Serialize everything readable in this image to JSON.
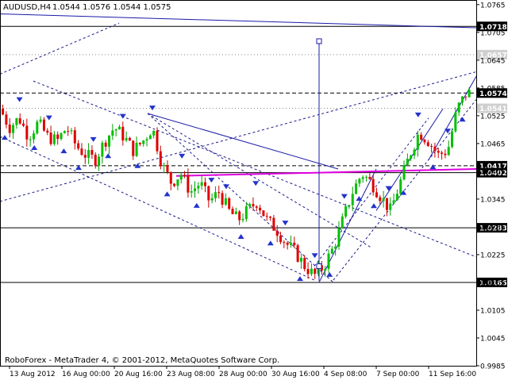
{
  "chart_data": {
    "type": "candlestick",
    "header": {
      "symbol": "AUDUSD,H4",
      "ohlc": "1.0544 1.0576 1.0544 1.0575"
    },
    "footer_text": "RoboForex - MetaTrader 4, © 2001-2012, MetaQuotes Software Corp.",
    "ylim": [
      0.9985,
      1.0775
    ],
    "y_ticks": [
      "1.0765",
      "1.0705",
      "1.0645",
      "1.0585",
      "1.0525",
      "1.0465",
      "1.0405",
      "1.0345",
      "1.0285",
      "1.0225",
      "1.0165",
      "1.0105",
      "1.0045",
      "0.9985"
    ],
    "x_ticks": [
      "13 Aug 2012",
      "16 Aug 00:00",
      "20 Aug 16:00",
      "23 Aug 08:00",
      "28 Aug 00:00",
      "30 Aug 16:00",
      "4 Sep 08:00",
      "7 Sep 00:00",
      "11 Sep 16:00"
    ],
    "x_range": [
      0,
      100
    ],
    "x_tick_positions": [
      2,
      13,
      24,
      35,
      46,
      57,
      68,
      79,
      90
    ],
    "price_levels": [
      {
        "label": "1.0718",
        "value": 1.0718,
        "style": "solid"
      },
      {
        "label": "1.0657",
        "value": 1.0657,
        "style": "dotted"
      },
      {
        "label": "1.0574",
        "value": 1.0574,
        "style": "dashed"
      },
      {
        "label": "1.0541",
        "value": 1.0541,
        "style": "dotted"
      },
      {
        "label": "1.0417",
        "value": 1.0417,
        "style": "dashed"
      },
      {
        "label": "1.0402",
        "value": 1.0402,
        "style": "solid"
      },
      {
        "label": "1.0283",
        "value": 1.0283,
        "style": "solid"
      },
      {
        "label": "1.0165",
        "value": 1.0165,
        "style": "solid"
      }
    ],
    "close_path": [
      [
        0,
        1.054
      ],
      [
        2,
        1.05
      ],
      [
        4,
        1.052
      ],
      [
        6,
        1.048
      ],
      [
        8,
        1.051
      ],
      [
        10,
        1.048
      ],
      [
        12,
        1.047
      ],
      [
        14,
        1.05
      ],
      [
        16,
        1.046
      ],
      [
        18,
        1.044
      ],
      [
        20,
        1.043
      ],
      [
        22,
        1.047
      ],
      [
        24,
        1.05
      ],
      [
        26,
        1.048
      ],
      [
        28,
        1.045
      ],
      [
        30,
        1.047
      ],
      [
        32,
        1.05
      ],
      [
        34,
        1.042
      ],
      [
        36,
        1.038
      ],
      [
        38,
        1.04
      ],
      [
        40,
        1.036
      ],
      [
        42,
        1.038
      ],
      [
        44,
        1.034
      ],
      [
        46,
        1.036
      ],
      [
        48,
        1.032
      ],
      [
        50,
        1.03
      ],
      [
        52,
        1.032
      ],
      [
        54,
        1.034
      ],
      [
        56,
        1.03
      ],
      [
        58,
        1.028
      ],
      [
        60,
        1.025
      ],
      [
        62,
        1.023
      ],
      [
        64,
        1.02
      ],
      [
        66,
        1.018
      ],
      [
        68,
        1.02
      ],
      [
        70,
        1.024
      ],
      [
        72,
        1.03
      ],
      [
        74,
        1.036
      ],
      [
        76,
        1.04
      ],
      [
        78,
        1.038
      ],
      [
        80,
        1.035
      ],
      [
        82,
        1.032
      ],
      [
        84,
        1.038
      ],
      [
        86,
        1.044
      ],
      [
        88,
        1.049
      ],
      [
        90,
        1.047
      ],
      [
        92,
        1.044
      ],
      [
        94,
        1.045
      ],
      [
        96,
        1.054
      ],
      [
        98,
        1.0575
      ]
    ],
    "trend_lines": [
      {
        "name": "top-channel",
        "style": "solid",
        "from": [
          0,
          1.0745
        ],
        "to": [
          100,
          1.0715
        ]
      },
      {
        "name": "fan-1",
        "style": "solid",
        "from": [
          31,
          1.053
        ],
        "to": [
          71,
          1.041
        ]
      },
      {
        "name": "dotted-upper",
        "style": "dotted",
        "from": [
          0,
          1.0615
        ],
        "to": [
          25,
          1.0725
        ]
      },
      {
        "name": "dotted-long",
        "style": "dotted",
        "from": [
          7,
          1.06
        ],
        "to": [
          100,
          1.022
        ]
      },
      {
        "name": "dotted-channel-1",
        "style": "dotted",
        "from": [
          0,
          1.048
        ],
        "to": [
          66,
          1.017
        ]
      },
      {
        "name": "dotted-channel-2",
        "style": "dotted",
        "from": [
          31,
          1.053
        ],
        "to": [
          78,
          1.024
        ]
      },
      {
        "name": "dotted-rise",
        "style": "dotted",
        "from": [
          0,
          1.034
        ],
        "to": [
          100,
          1.062
        ]
      },
      {
        "name": "dotted-fan-low",
        "style": "dotted",
        "from": [
          31,
          1.053
        ],
        "to": [
          70,
          1.0165
        ]
      },
      {
        "name": "bull-1",
        "style": "solid",
        "from": [
          67,
          1.0165
        ],
        "to": [
          79,
          1.041
        ]
      },
      {
        "name": "bull-2",
        "style": "solid",
        "from": [
          79,
          1.032
        ],
        "to": [
          93,
          1.054
        ]
      },
      {
        "name": "bull-3",
        "style": "solid",
        "from": [
          90,
          1.043
        ],
        "to": [
          100,
          1.061
        ]
      },
      {
        "name": "channel-a",
        "style": "dotted",
        "from": [
          70,
          1.017
        ],
        "to": [
          100,
          1.056
        ]
      },
      {
        "name": "channel-b",
        "style": "dotted",
        "from": [
          66,
          1.02
        ],
        "to": [
          90,
          1.052
        ]
      }
    ],
    "magenta_line": {
      "from": [
        37,
        1.0395
      ],
      "to": [
        100,
        1.041
      ]
    },
    "vertical_marker": {
      "x": 67,
      "from": 1.0168,
      "to": 1.0686
    },
    "target_box": {
      "x": 67,
      "y": 1.02
    }
  }
}
